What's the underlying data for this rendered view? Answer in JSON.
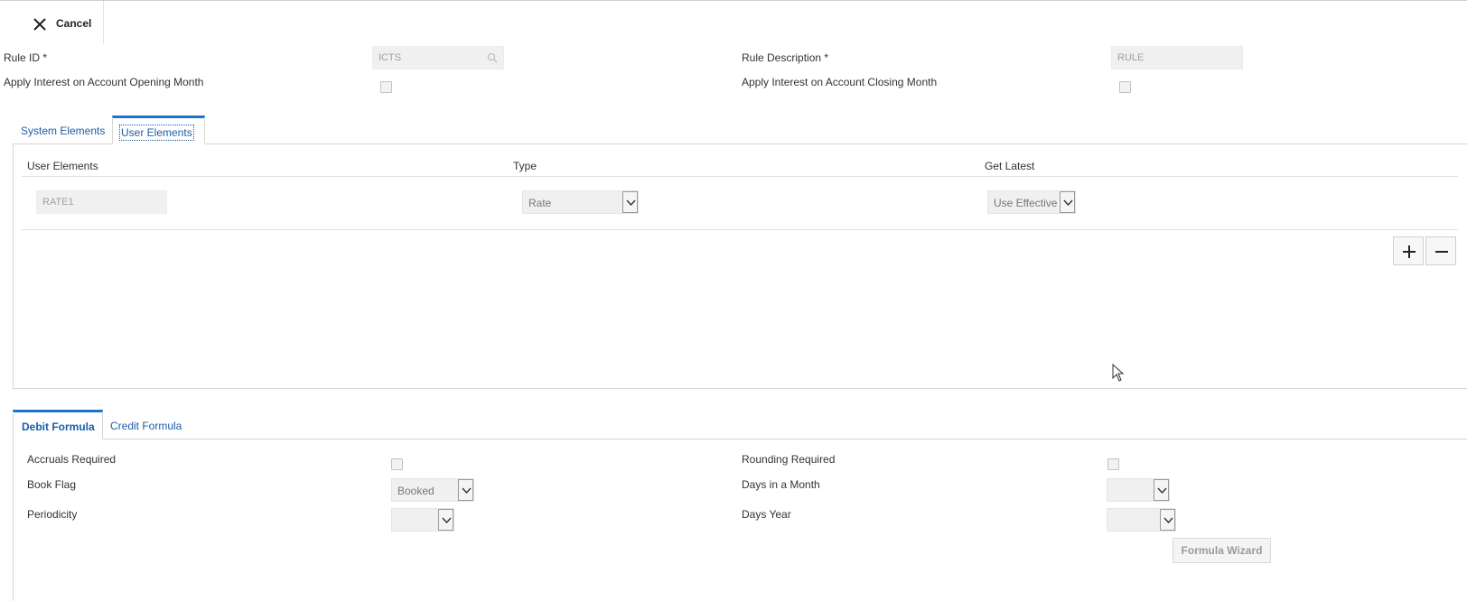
{
  "toolbar": {
    "cancel_label": "Cancel"
  },
  "header": {
    "rule_id_label": "Rule ID *",
    "rule_id_value": "ICTS",
    "rule_description_label": "Rule Description *",
    "rule_description_value": "RULE",
    "apply_opening_label": "Apply Interest on Account Opening Month",
    "apply_closing_label": "Apply Interest on Account Closing Month"
  },
  "elements_tabs": [
    {
      "label": "System Elements"
    },
    {
      "label": "User Elements"
    }
  ],
  "user_elements": {
    "columns": [
      "User Elements",
      "Type",
      "Get Latest"
    ],
    "rows": [
      {
        "element": "RATE1",
        "type": "Rate",
        "get_latest": "Use Effective"
      }
    ]
  },
  "formula_tabs": [
    {
      "label": "Debit Formula"
    },
    {
      "label": "Credit Formula"
    }
  ],
  "formula": {
    "accruals_required_label": "Accruals Required",
    "rounding_required_label": "Rounding Required",
    "book_flag_label": "Book Flag",
    "book_flag_value": "Booked",
    "days_in_month_label": "Days in a Month",
    "days_in_month_value": "",
    "periodicity_label": "Periodicity",
    "periodicity_value": "",
    "days_year_label": "Days Year",
    "days_year_value": "",
    "formula_wizard_label": "Formula Wizard"
  },
  "colors": {
    "accent": "#1a73c8",
    "link": "#1a5ea8"
  }
}
